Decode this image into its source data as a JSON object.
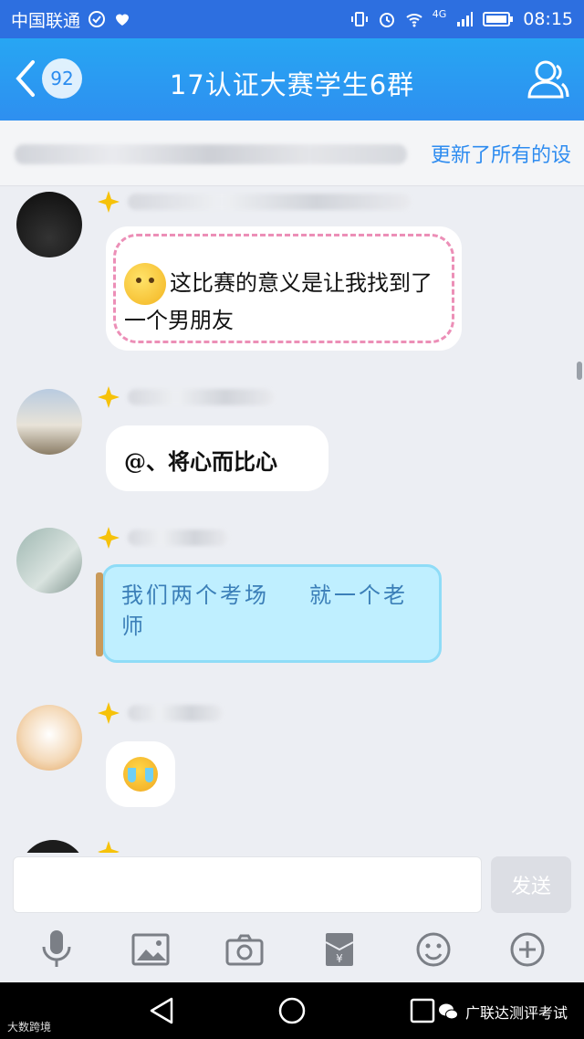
{
  "status_bar": {
    "carrier": "中国联通",
    "network": "4G",
    "time": "08:15"
  },
  "header": {
    "unread_count": "92",
    "title": "17认证大赛学生6群"
  },
  "notice": {
    "text": "更新了所有的设"
  },
  "messages": [
    {
      "id": "m1",
      "text": "这比赛的意义是让我找到了一个男朋友",
      "style": "dashed-pink"
    },
    {
      "id": "m2",
      "text": "@、将心而比心",
      "style": "plain"
    },
    {
      "id": "m3",
      "text_a": "我们两个考场",
      "text_b": "就一个老",
      "text_c": "师",
      "style": "bottle"
    },
    {
      "id": "m4",
      "emoji": "crying-laughing-emoji",
      "style": "plain"
    }
  ],
  "input": {
    "send_label": "发送"
  },
  "toolbar": {
    "items": [
      "microphone-icon",
      "image-icon",
      "camera-icon",
      "red-packet-icon",
      "smiley-icon",
      "plus-icon"
    ]
  },
  "watermark": {
    "right": "广联达测评考试",
    "left": "大数跨境"
  },
  "colors": {
    "header": "#2e8ff0",
    "accent": "#2e8cf0",
    "bubble_bottle": "#bfefff"
  }
}
